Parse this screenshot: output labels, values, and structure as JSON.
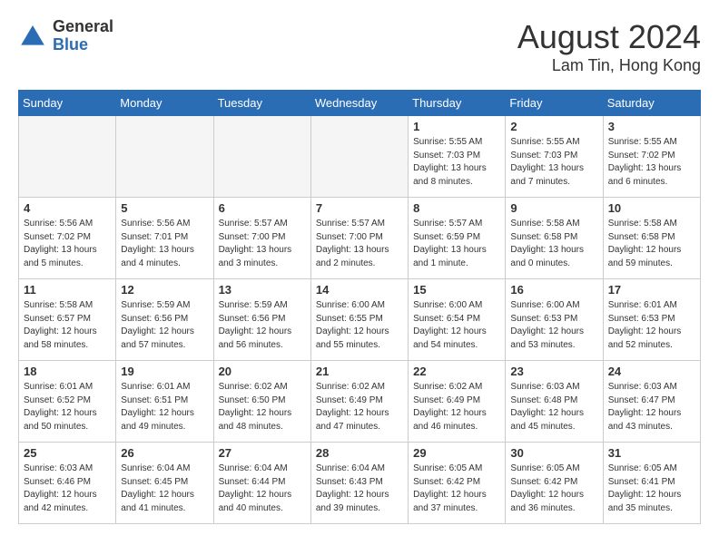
{
  "header": {
    "logo_line1": "General",
    "logo_line2": "Blue",
    "title": "August 2024",
    "subtitle": "Lam Tin, Hong Kong"
  },
  "days_of_week": [
    "Sunday",
    "Monday",
    "Tuesday",
    "Wednesday",
    "Thursday",
    "Friday",
    "Saturday"
  ],
  "weeks": [
    [
      {
        "day": "",
        "empty": true
      },
      {
        "day": "",
        "empty": true
      },
      {
        "day": "",
        "empty": true
      },
      {
        "day": "",
        "empty": true
      },
      {
        "day": "1",
        "sunrise": "5:55 AM",
        "sunset": "7:03 PM",
        "daylight": "13 hours and 8 minutes."
      },
      {
        "day": "2",
        "sunrise": "5:55 AM",
        "sunset": "7:03 PM",
        "daylight": "13 hours and 7 minutes."
      },
      {
        "day": "3",
        "sunrise": "5:55 AM",
        "sunset": "7:02 PM",
        "daylight": "13 hours and 6 minutes."
      }
    ],
    [
      {
        "day": "4",
        "sunrise": "5:56 AM",
        "sunset": "7:02 PM",
        "daylight": "13 hours and 5 minutes."
      },
      {
        "day": "5",
        "sunrise": "5:56 AM",
        "sunset": "7:01 PM",
        "daylight": "13 hours and 4 minutes."
      },
      {
        "day": "6",
        "sunrise": "5:57 AM",
        "sunset": "7:00 PM",
        "daylight": "13 hours and 3 minutes."
      },
      {
        "day": "7",
        "sunrise": "5:57 AM",
        "sunset": "7:00 PM",
        "daylight": "13 hours and 2 minutes."
      },
      {
        "day": "8",
        "sunrise": "5:57 AM",
        "sunset": "6:59 PM",
        "daylight": "13 hours and 1 minute."
      },
      {
        "day": "9",
        "sunrise": "5:58 AM",
        "sunset": "6:58 PM",
        "daylight": "13 hours and 0 minutes."
      },
      {
        "day": "10",
        "sunrise": "5:58 AM",
        "sunset": "6:58 PM",
        "daylight": "12 hours and 59 minutes."
      }
    ],
    [
      {
        "day": "11",
        "sunrise": "5:58 AM",
        "sunset": "6:57 PM",
        "daylight": "12 hours and 58 minutes."
      },
      {
        "day": "12",
        "sunrise": "5:59 AM",
        "sunset": "6:56 PM",
        "daylight": "12 hours and 57 minutes."
      },
      {
        "day": "13",
        "sunrise": "5:59 AM",
        "sunset": "6:56 PM",
        "daylight": "12 hours and 56 minutes."
      },
      {
        "day": "14",
        "sunrise": "6:00 AM",
        "sunset": "6:55 PM",
        "daylight": "12 hours and 55 minutes."
      },
      {
        "day": "15",
        "sunrise": "6:00 AM",
        "sunset": "6:54 PM",
        "daylight": "12 hours and 54 minutes."
      },
      {
        "day": "16",
        "sunrise": "6:00 AM",
        "sunset": "6:53 PM",
        "daylight": "12 hours and 53 minutes."
      },
      {
        "day": "17",
        "sunrise": "6:01 AM",
        "sunset": "6:53 PM",
        "daylight": "12 hours and 52 minutes."
      }
    ],
    [
      {
        "day": "18",
        "sunrise": "6:01 AM",
        "sunset": "6:52 PM",
        "daylight": "12 hours and 50 minutes."
      },
      {
        "day": "19",
        "sunrise": "6:01 AM",
        "sunset": "6:51 PM",
        "daylight": "12 hours and 49 minutes."
      },
      {
        "day": "20",
        "sunrise": "6:02 AM",
        "sunset": "6:50 PM",
        "daylight": "12 hours and 48 minutes."
      },
      {
        "day": "21",
        "sunrise": "6:02 AM",
        "sunset": "6:49 PM",
        "daylight": "12 hours and 47 minutes."
      },
      {
        "day": "22",
        "sunrise": "6:02 AM",
        "sunset": "6:49 PM",
        "daylight": "12 hours and 46 minutes."
      },
      {
        "day": "23",
        "sunrise": "6:03 AM",
        "sunset": "6:48 PM",
        "daylight": "12 hours and 45 minutes."
      },
      {
        "day": "24",
        "sunrise": "6:03 AM",
        "sunset": "6:47 PM",
        "daylight": "12 hours and 43 minutes."
      }
    ],
    [
      {
        "day": "25",
        "sunrise": "6:03 AM",
        "sunset": "6:46 PM",
        "daylight": "12 hours and 42 minutes."
      },
      {
        "day": "26",
        "sunrise": "6:04 AM",
        "sunset": "6:45 PM",
        "daylight": "12 hours and 41 minutes."
      },
      {
        "day": "27",
        "sunrise": "6:04 AM",
        "sunset": "6:44 PM",
        "daylight": "12 hours and 40 minutes."
      },
      {
        "day": "28",
        "sunrise": "6:04 AM",
        "sunset": "6:43 PM",
        "daylight": "12 hours and 39 minutes."
      },
      {
        "day": "29",
        "sunrise": "6:05 AM",
        "sunset": "6:42 PM",
        "daylight": "12 hours and 37 minutes."
      },
      {
        "day": "30",
        "sunrise": "6:05 AM",
        "sunset": "6:42 PM",
        "daylight": "12 hours and 36 minutes."
      },
      {
        "day": "31",
        "sunrise": "6:05 AM",
        "sunset": "6:41 PM",
        "daylight": "12 hours and 35 minutes."
      }
    ]
  ]
}
